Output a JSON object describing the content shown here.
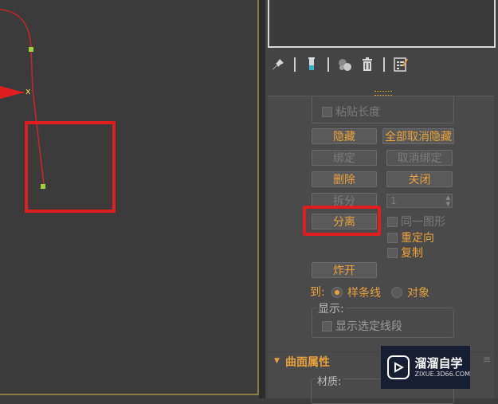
{
  "panel": {
    "paste_length_label": "粘贴长度",
    "buttons": {
      "hide": "隐藏",
      "unhide_all": "全部取消隐藏",
      "bind": "绑定",
      "unbind": "取消绑定",
      "delete": "删除",
      "close": "关闭",
      "divide": "拆分",
      "detach": "分离",
      "explode": "炸开"
    },
    "divide_count": "1",
    "checkboxes": {
      "same_shape": "同一图形",
      "reorient": "重定向",
      "copy": "复制",
      "show_selected_segments": "显示选定线段"
    },
    "to_label": "到:",
    "radio_spline": "样条线",
    "radio_object": "对象",
    "display_label": "显示:",
    "surface_title": "曲面属性",
    "material_label": "材质:"
  },
  "watermark": {
    "title": "溜溜自学",
    "subtitle": "ZIXUE.3D66.COM"
  },
  "colors": {
    "accent": "#e9a23b",
    "highlight": "#e11d1d",
    "spline": "#c0282a",
    "vertex": "#9bd23c"
  },
  "icons": [
    "pin-icon",
    "show-end-result-icon",
    "make-unique-icon",
    "remove-modifier-icon",
    "configure-modifier-sets-icon"
  ]
}
